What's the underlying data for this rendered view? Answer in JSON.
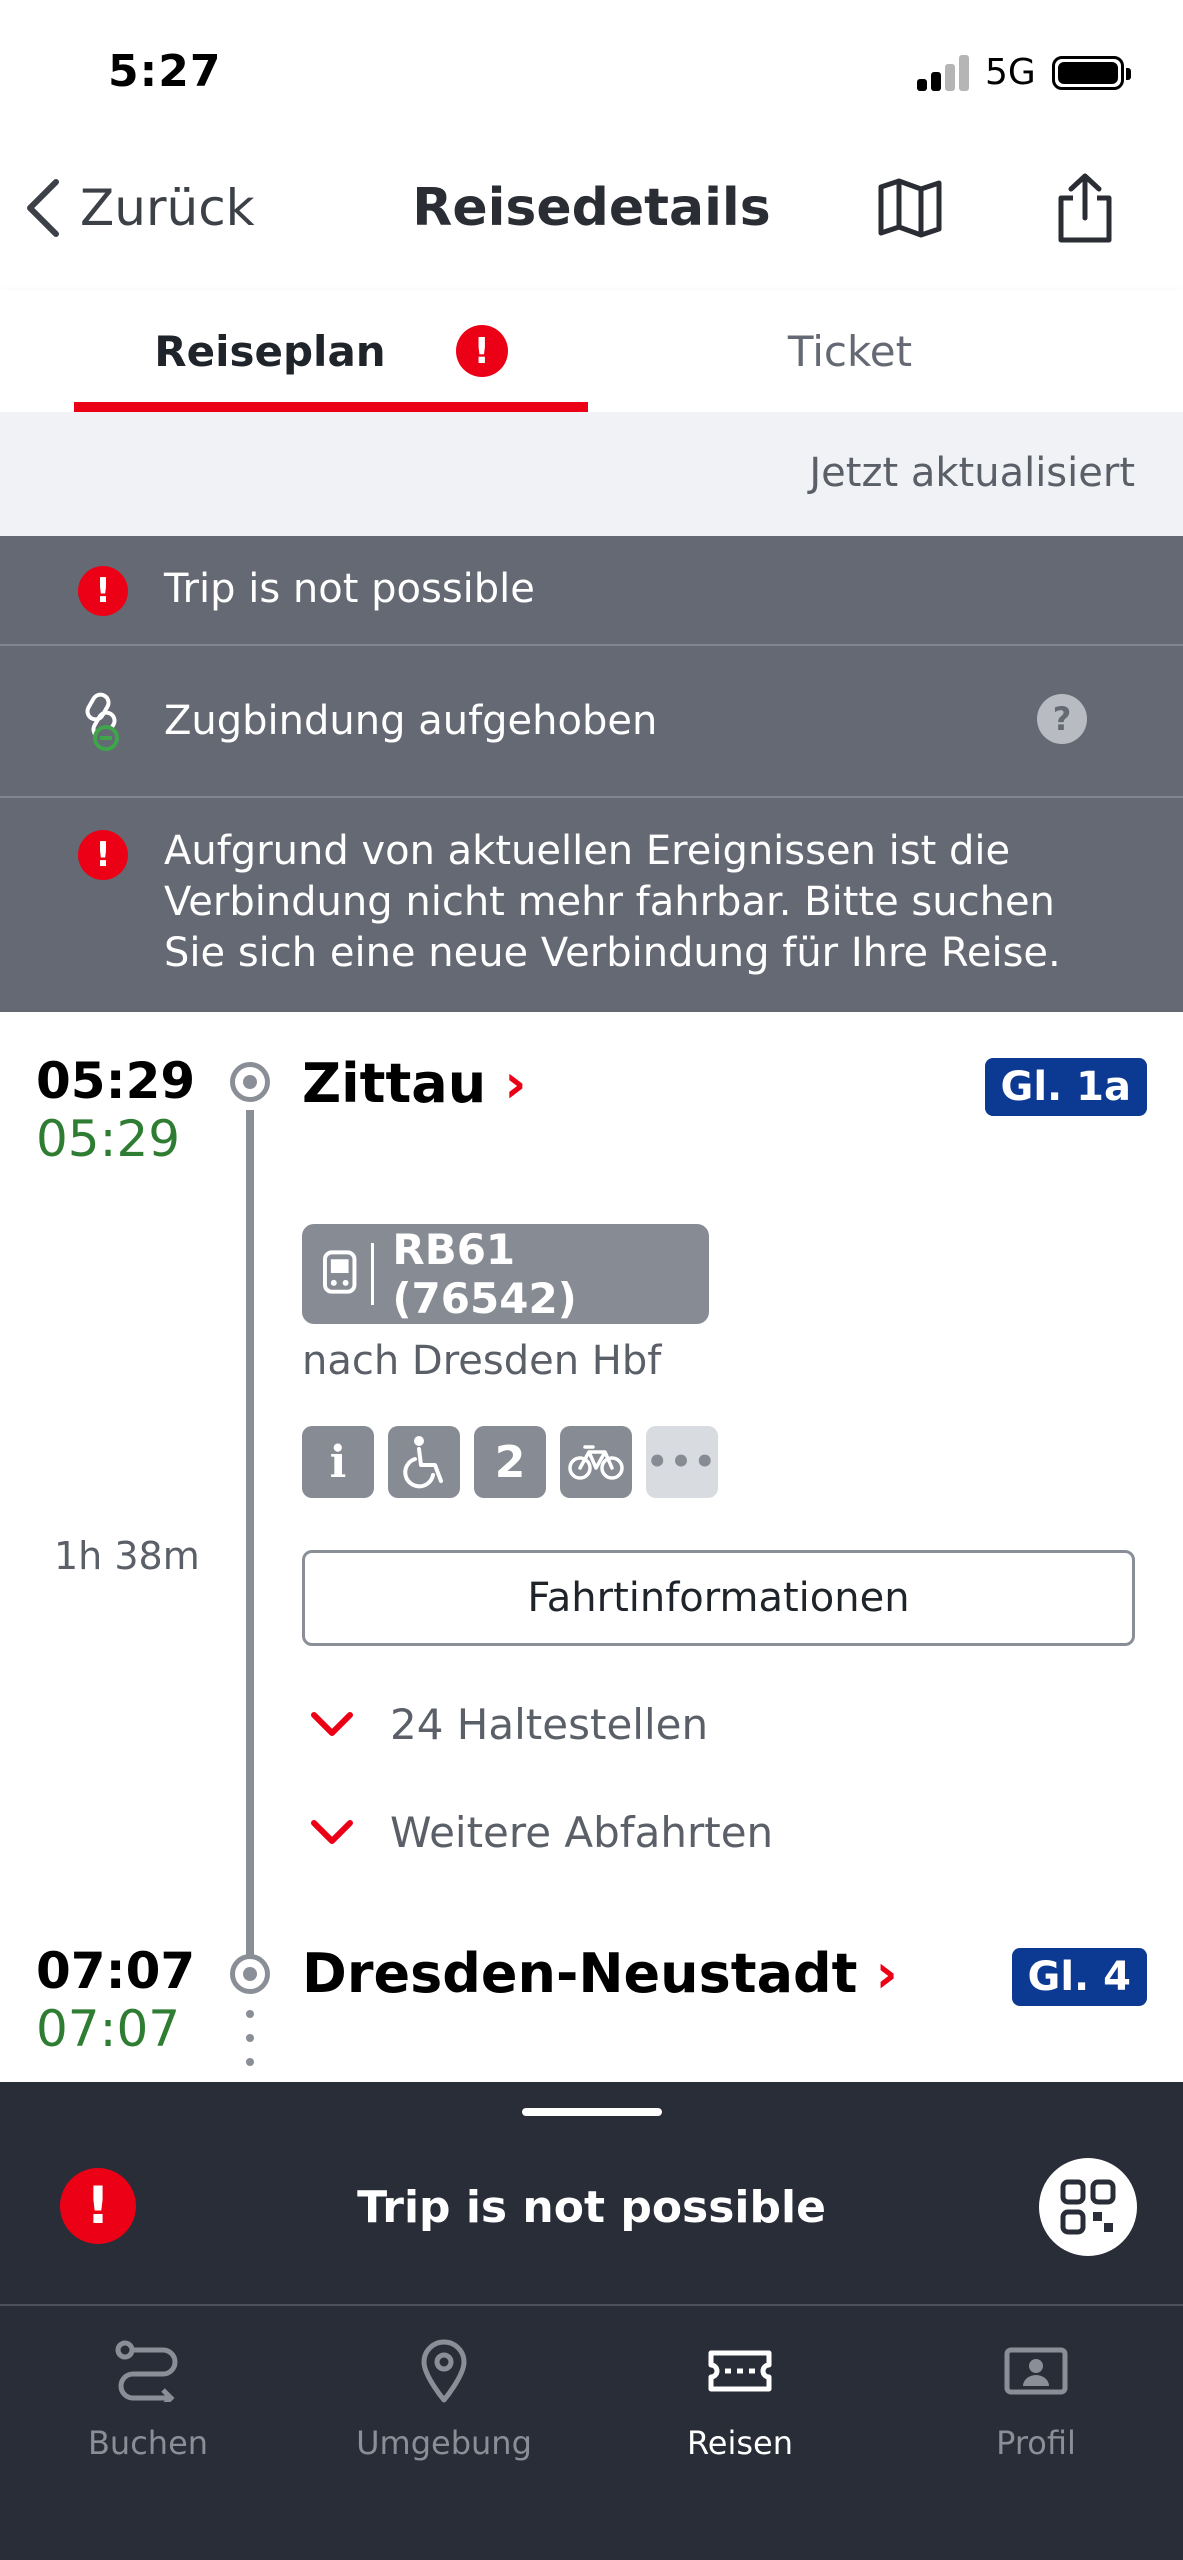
{
  "status_bar": {
    "time": "5:27",
    "network": "5G"
  },
  "header": {
    "back_label": "Zurück",
    "title": "Reisedetails"
  },
  "tabs": [
    {
      "label": "Reiseplan",
      "active": true,
      "alert": "!"
    },
    {
      "label": "Ticket",
      "active": false
    }
  ],
  "updated_text": "Jetzt aktualisiert",
  "alerts": [
    {
      "icon": "alert-icon",
      "text": "Trip is not possible"
    },
    {
      "icon": "chain-unlinked-icon",
      "text": "Zugbindung aufgehoben",
      "help": "?"
    },
    {
      "icon": "alert-icon",
      "lines": [
        "Aufgrund von aktuellen Ereignissen ist die",
        "Verbindung nicht mehr fahrbar. Bitte suchen",
        "Sie sich eine neue Verbindung für Ihre Reise."
      ]
    }
  ],
  "journey": {
    "departure": {
      "time_planned": "05:29",
      "time_actual": "05:29",
      "station": "Zittau",
      "platform": "Gl. 1a"
    },
    "train": {
      "label": "RB61 (76542)",
      "destination": "nach Dresden Hbf"
    },
    "features": [
      "i",
      "wheelchair-icon",
      "2",
      "bicycle-icon",
      "more-icon"
    ],
    "features_text": {
      "info": "i",
      "class": "2",
      "more": "•••"
    },
    "duration": "1h 38m",
    "info_button": "Fahrtinformationen",
    "stops_label": "24 Haltestellen",
    "more_departures_label": "Weitere Abfahrten",
    "arrival": {
      "time_planned": "07:07",
      "time_actual": "07:07",
      "station": "Dresden-Neustadt",
      "platform": "Gl. 4"
    }
  },
  "bottom_sheet": {
    "title": "Trip is not possible",
    "alert": "!"
  },
  "tab_bar": [
    {
      "label": "Buchen",
      "icon": "route-icon",
      "active": false
    },
    {
      "label": "Umgebung",
      "icon": "location-pin-icon",
      "active": false
    },
    {
      "label": "Reisen",
      "icon": "ticket-icon",
      "active": true
    },
    {
      "label": "Profil",
      "icon": "profile-card-icon",
      "active": false
    }
  ],
  "colors": {
    "accent_red": "#ec0016",
    "platform_blue": "#0c3992",
    "alert_gray": "#646973",
    "dark_bar": "#282d37",
    "on_time_green": "#2e7d32"
  }
}
